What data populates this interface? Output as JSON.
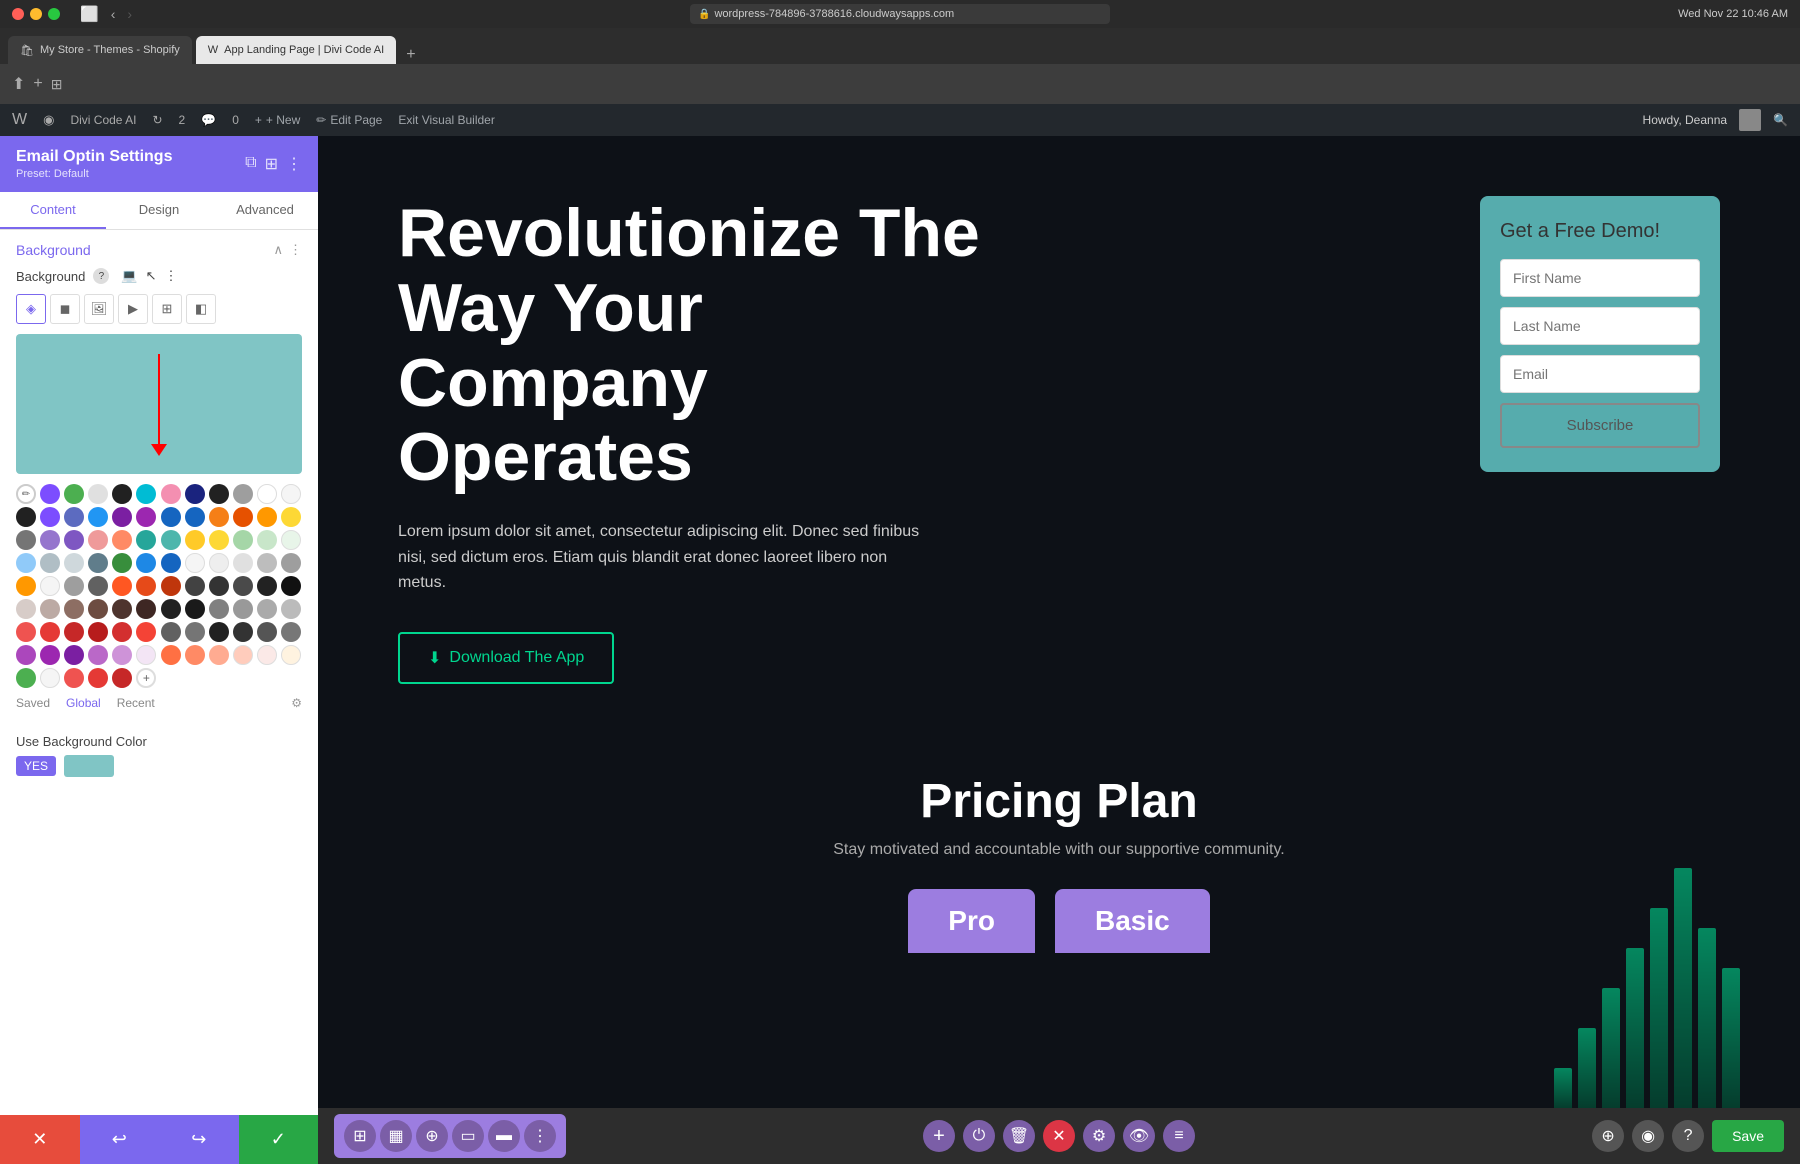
{
  "mac": {
    "bar_bg": "#2a2a2a",
    "address": "wordpress-784896-3788616.cloudwaysapps.com",
    "lock_icon": "🔒",
    "reload_icon": "↻",
    "time": "Wed Nov 22  10:46 AM"
  },
  "browser": {
    "tab1": {
      "label": "My Store - Themes - Shopify",
      "icon": "🛍"
    },
    "tab2": {
      "label": "App Landing Page | Divi Code AI",
      "icon": "W"
    }
  },
  "wp_bar": {
    "logo": "W",
    "divi_code_ai": "Divi Code AI",
    "edits": "2",
    "comments": "0",
    "new_label": "+ New",
    "edit_page": "Edit Page",
    "exit_builder": "Exit Visual Builder",
    "howdy": "Howdy, Deanna"
  },
  "left_panel": {
    "title": "Email Optin Settings",
    "preset": "Preset: Default",
    "tabs": [
      "Content",
      "Design",
      "Advanced"
    ],
    "active_tab": "Content",
    "section": {
      "title": "Background",
      "bg_label": "Background",
      "help_icon": "?",
      "bg_types": [
        "gradient",
        "color",
        "image",
        "video",
        "pattern",
        "mask"
      ],
      "saved_label": "Saved",
      "global_label": "Global",
      "recent_label": "Recent",
      "use_bg_label": "Use Background Color",
      "toggle_yes": "YES"
    }
  },
  "color_palette": {
    "preview_color": "#80c5c5",
    "rows": [
      [
        "#7c4dff",
        "#4caf50",
        "#e0e0e0",
        "#212121",
        "#00bcd4",
        "#f48fb1",
        "#1a237e",
        "#212121",
        "#9e9e9e"
      ],
      [
        "#212121",
        "#7c4dff",
        "#5c6bc0",
        "#2196f3",
        "#7b1fa2",
        "#9c27b0",
        "#1565c0",
        "#f57f17",
        "#e65100"
      ],
      [
        "#757575",
        "#9575cd",
        "#7e57c2",
        "#ef9a9a",
        "#ff8a65",
        "#26a69a",
        "#4db6ac",
        "#ffca28",
        "#fdd835"
      ],
      [
        "#90caf9",
        "#b0bec5",
        "#cfd8dc",
        "#6c757d",
        "#388e3c",
        "#1e88e5",
        "#1565c0",
        "#f5f5f5"
      ],
      [
        "#ff9800",
        "#f5f5f5",
        "#9e9e9e",
        "#616161",
        "#ff5722",
        "#e64a19",
        "#bf360c",
        "#424242"
      ],
      [
        "#d7ccc8",
        "#bcaaa4",
        "#8d6e63",
        "#6d4c41",
        "#4e342e",
        "#3e2723",
        "#212121"
      ],
      [
        "#ef5350",
        "#e53935",
        "#c62828",
        "#b71c1c",
        "#d32f2f",
        "#f44336"
      ],
      [
        "#ab47bc",
        "#9c27b0",
        "#7b1fa2",
        "#ba68c8",
        "#ce93d8",
        "#f3e5f5"
      ],
      [
        "#4caf50",
        "#388e3c",
        "#2e7d32",
        "#81c784",
        "#a5d6a7",
        "#c8e6c9",
        "+"
      ]
    ]
  },
  "hero": {
    "heading": "Revolutionize The Way Your Company Operates",
    "subtext": "Lorem ipsum dolor sit amet, consectetur adipiscing elit. Donec sed finibus nisi, sed dictum eros. Etiam quis blandit erat donec laoreet libero non metus.",
    "cta_label": "Download The App",
    "cta_icon": "⬇"
  },
  "form_card": {
    "title": "Get a Free Demo!",
    "first_name_placeholder": "First Name",
    "last_name_placeholder": "Last Name",
    "email_placeholder": "Email",
    "subscribe_label": "Subscribe"
  },
  "pricing": {
    "title": "Pricing Plan",
    "subtitle": "Stay motivated and accountable with our supportive community.",
    "cards": [
      {
        "label": "Pro"
      },
      {
        "label": "Basic"
      }
    ]
  },
  "bottom_toolbar": {
    "grid_icon": "⊞",
    "layout_icon": "▦",
    "search_icon": "⊕",
    "device_icon": "▭",
    "columns_icon": "▬",
    "more_icon": "⋮",
    "add_btn": "+",
    "power_btn": "⏻",
    "trash_btn": "🗑",
    "close_btn": "✕",
    "settings_btn": "⚙",
    "eye_btn": "👁",
    "bars_btn": "≡",
    "search2_icon": "⊕",
    "help_icon": "?",
    "display_icon": "◉",
    "save_label": "Save"
  }
}
